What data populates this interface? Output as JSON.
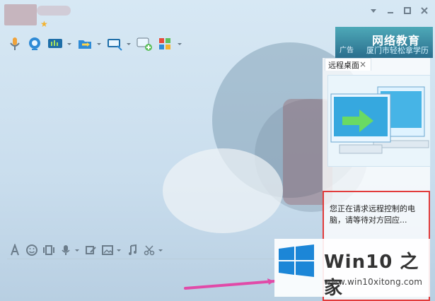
{
  "titlebar": {
    "controls": [
      {
        "name": "menu-caret-icon"
      },
      {
        "name": "minimize-icon"
      },
      {
        "name": "maximize-icon"
      },
      {
        "name": "close-icon"
      }
    ]
  },
  "toolbar": {
    "items": [
      {
        "name": "microphone-icon"
      },
      {
        "name": "webcam-icon"
      },
      {
        "name": "screen-share-icon"
      },
      {
        "name": "file-transfer-icon"
      },
      {
        "name": "remote-desktop-icon"
      },
      {
        "name": "add-chat-icon"
      },
      {
        "name": "apps-icon"
      }
    ]
  },
  "ad": {
    "tag": "广告",
    "title": "网络教育",
    "subtitle": "厦门市轻松拿学历"
  },
  "remote_panel": {
    "tab_label": "远程桌面",
    "message": "您正在请求远程控制的电脑，请等待对方回应..."
  },
  "input_toolbar": {
    "items": [
      {
        "name": "font-icon"
      },
      {
        "name": "emoji-icon"
      },
      {
        "name": "shake-icon"
      },
      {
        "name": "voice-icon"
      },
      {
        "name": "edit-icon"
      },
      {
        "name": "image-icon"
      },
      {
        "name": "music-icon"
      },
      {
        "name": "cut-icon"
      }
    ]
  },
  "watermark": {
    "title": "Win10 之家",
    "url": "www.win10xitong.com"
  },
  "colors": {
    "accent": "#2f8bd6",
    "highlight_red": "#e23b3b",
    "ad_bg": "#2a6e8d"
  }
}
